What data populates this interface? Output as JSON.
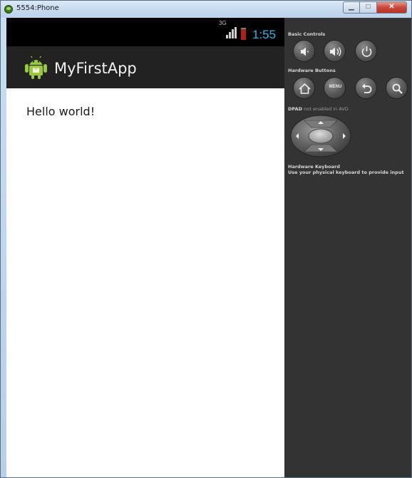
{
  "window": {
    "title": "5554:Phone",
    "buttons": {
      "minimize": "▁",
      "maximize": "□",
      "close": "✕"
    }
  },
  "status_bar": {
    "network": "3G",
    "time": "1:55",
    "colors": {
      "time": "#33b5e5",
      "battery": "#b01e1e"
    }
  },
  "action_bar": {
    "icon": "android-robot-icon",
    "title": "MyFirstApp"
  },
  "content": {
    "text": "Hello world!"
  },
  "controls": {
    "basic_label": "Basic Controls",
    "basic_buttons": [
      "volume-down-icon",
      "volume-up-icon",
      "power-icon"
    ],
    "hardware_label": "Hardware Buttons",
    "hardware_buttons": [
      "home-icon",
      "menu-button",
      "back-icon",
      "search-icon"
    ],
    "menu_label": "MENU",
    "dpad_label": "DPAD",
    "dpad_hint": "not enabled in AVD",
    "keyboard_label": "Hardware Keyboard",
    "keyboard_hint": "Use your physical keyboard to provide input"
  }
}
